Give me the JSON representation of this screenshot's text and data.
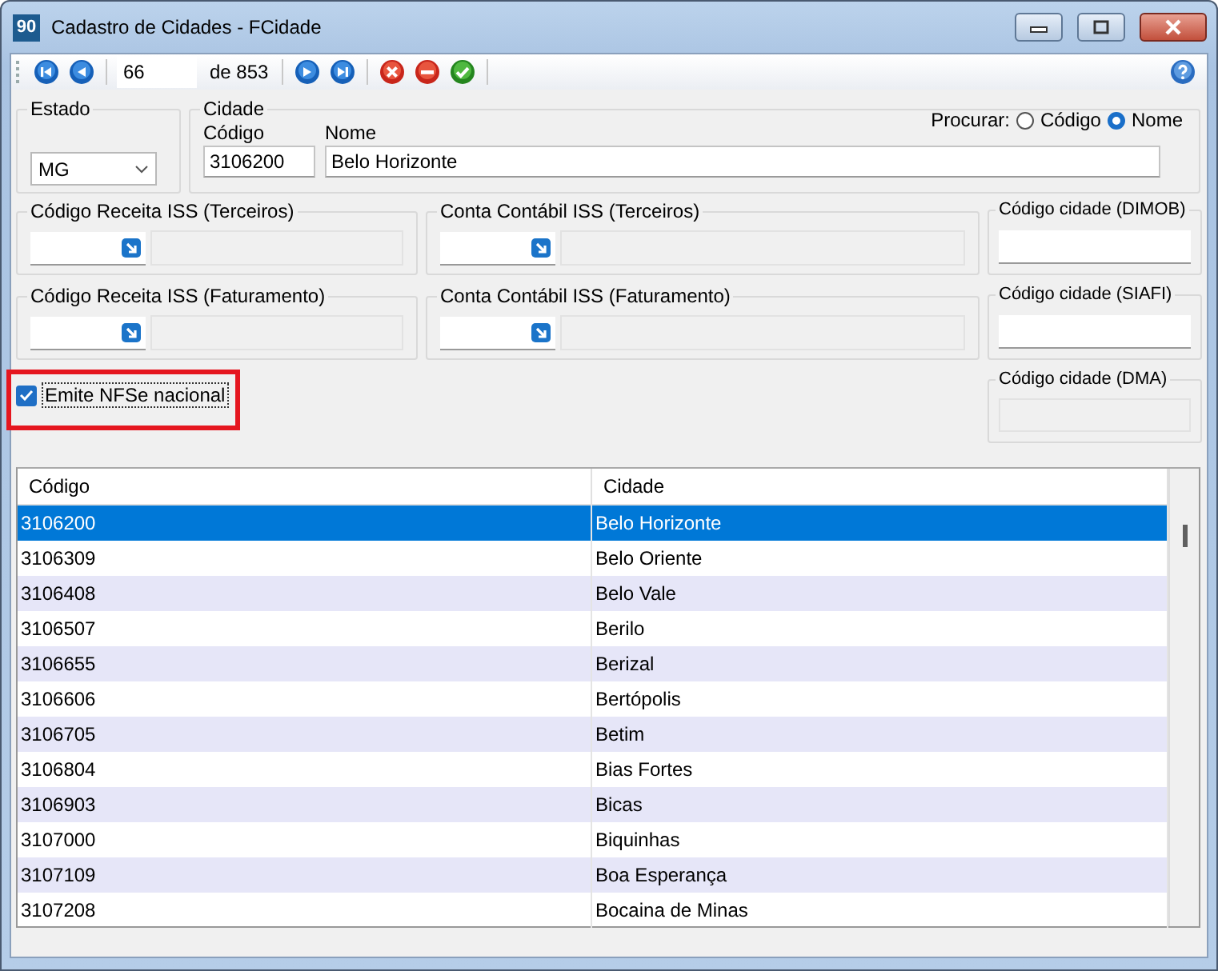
{
  "window": {
    "title": "Cadastro de Cidades - FCidade",
    "app_icon": "90"
  },
  "toolbar": {
    "record": "66",
    "total": "de 853"
  },
  "estado": {
    "label": "Estado",
    "value": "MG"
  },
  "cidade": {
    "label": "Cidade",
    "codigo_label": "Código",
    "codigo": "3106200",
    "nome_label": "Nome",
    "nome": "Belo Horizonte",
    "search_label": "Procurar:",
    "search_options": [
      {
        "label": "Código",
        "selected": false
      },
      {
        "label": "Nome",
        "selected": true
      }
    ]
  },
  "lookups": [
    {
      "label": "Código Receita ISS (Terceiros)"
    },
    {
      "label": "Conta Contábil ISS (Terceiros)"
    },
    {
      "label": "Código Receita ISS (Faturamento)"
    },
    {
      "label": "Conta Contábil ISS (Faturamento)"
    }
  ],
  "city_codes": [
    {
      "label": "Código cidade (DIMOB)",
      "disabled": false
    },
    {
      "label": "Código cidade (SIAFI)",
      "disabled": false
    },
    {
      "label": "Código cidade (DMA)",
      "disabled": true
    }
  ],
  "emite_nfse": {
    "label": "Emite NFSe nacional",
    "checked": true
  },
  "table": {
    "columns": [
      "Código",
      "Cidade"
    ],
    "rows": [
      {
        "cells": [
          "3106200",
          "Belo Horizonte"
        ],
        "selected": true
      },
      {
        "cells": [
          "3106309",
          "Belo Oriente"
        ],
        "selected": false
      },
      {
        "cells": [
          "3106408",
          "Belo Vale"
        ],
        "selected": false
      },
      {
        "cells": [
          "3106507",
          "Berilo"
        ],
        "selected": false
      },
      {
        "cells": [
          "3106655",
          "Berizal"
        ],
        "selected": false
      },
      {
        "cells": [
          "3106606",
          "Bertópolis"
        ],
        "selected": false
      },
      {
        "cells": [
          "3106705",
          "Betim"
        ],
        "selected": false
      },
      {
        "cells": [
          "3106804",
          "Bias Fortes"
        ],
        "selected": false
      },
      {
        "cells": [
          "3106903",
          "Bicas"
        ],
        "selected": false
      },
      {
        "cells": [
          "3107000",
          "Biquinhas"
        ],
        "selected": false
      },
      {
        "cells": [
          "3107109",
          "Boa Esperança"
        ],
        "selected": false
      },
      {
        "cells": [
          "3107208",
          "Bocaina de Minas"
        ],
        "selected": false
      }
    ]
  }
}
